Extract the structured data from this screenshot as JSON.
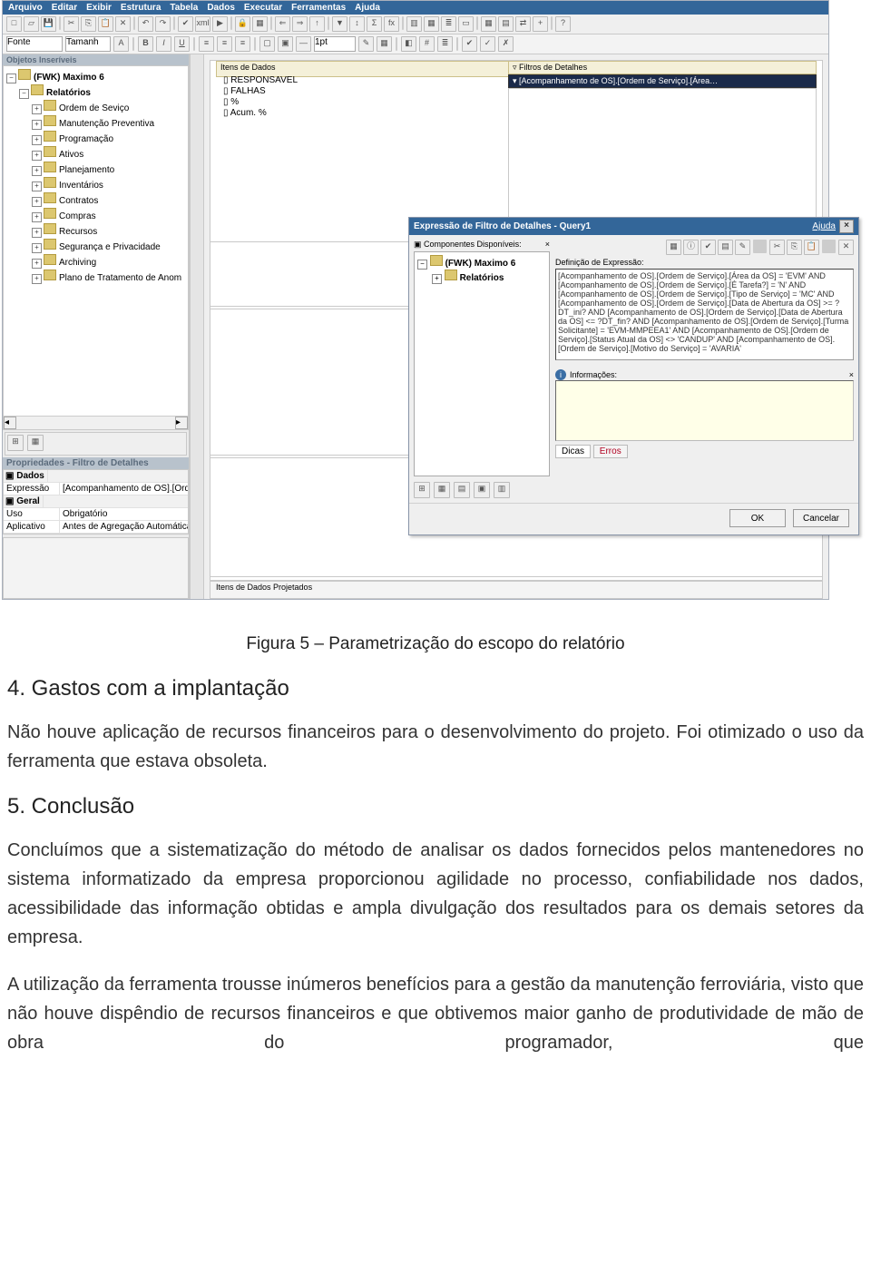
{
  "menu": {
    "items": [
      "Arquivo",
      "Editar",
      "Exibir",
      "Estrutura",
      "Tabela",
      "Dados",
      "Executar",
      "Ferramentas",
      "Ajuda"
    ]
  },
  "formatbar": {
    "font_label": "Fonte",
    "size_label": "Tamanh",
    "pt": "1pt"
  },
  "panels": {
    "objetos_title": "Objetos Inseríveis",
    "props_title": "Propriedades   -   Filtro de Detalhes"
  },
  "tree": {
    "root": "(FWK) Maximo 6",
    "relatorios": "Relatórios",
    "items": [
      "Ordem de Seviço",
      "Manutenção Preventiva",
      "Programação",
      "Ativos",
      "Planejamento",
      "Inventários",
      "Contratos",
      "Compras",
      "Recursos",
      "Segurança e Privacidade",
      "Archiving",
      "Plano de Tratamento de Anom"
    ]
  },
  "props": {
    "dados": "Dados",
    "expr_k": "Expressão",
    "expr_v": "[Acompanhamento de OS].[Orde…",
    "geral": "Geral",
    "uso_k": "Uso",
    "uso_v": "Obrigatório",
    "apl_k": "Aplicativo",
    "apl_v": "Antes de Agregação Automática"
  },
  "canvas": {
    "itens_header": "Itens de Dados",
    "itens": [
      "RESPONSAVEL",
      "FALHAS",
      "%",
      "Acum. %"
    ],
    "filtros_header": "Filtros de Detalhes",
    "filtros_row": "[Acompanhamento de OS].[Ordem de Serviço].[Área…",
    "status": "Itens de Dados Projetados"
  },
  "dialog": {
    "title": "Expressão de Filtro de Detalhes - Query1",
    "help": "Ajuda",
    "comp_label": "Componentes Disponíveis:",
    "tree_root": "(FWK) Maximo 6",
    "tree_child": "Relatórios",
    "def_label": "Definição de Expressão:",
    "expr": "[Acompanhamento de OS].[Ordem de Serviço].[Área da OS] = 'EVM' AND [Acompanhamento de OS].[Ordem de Serviço].[É Tarefa?] = 'N' AND [Acompanhamento de OS].[Ordem de Serviço].[Tipo de Serviço] = 'MC' AND [Acompanhamento de OS].[Ordem de Serviço].[Data de Abertura da OS] >= ?DT_ini? AND [Acompanhamento de OS].[Ordem de Serviço].[Data de Abertura da OS] <= ?DT_fin? AND [Acompanhamento de OS].[Ordem de Serviço].[Turma Solicitante] = 'EVM-MMPEEA1' AND [Acompanhamento de OS].[Ordem de Serviço].[Status Atual da OS] <> 'CANDUP' AND [Acompanhamento de OS].[Ordem de Serviço].[Motivo do Serviço]  =  'AVARIA'",
    "info_label": "Informações:",
    "tabs": [
      "Dicas",
      "Erros"
    ],
    "ok": "OK",
    "cancel": "Cancelar"
  },
  "doc": {
    "caption": "Figura 5 – Parametrização do escopo do relatório",
    "h4": "4. Gastos com a implantação",
    "p4": "Não houve aplicação de recursos financeiros para o desenvolvimento do projeto. Foi otimizado o uso da ferramenta que estava obsoleta.",
    "h5": "5. Conclusão",
    "p5a": "Concluímos que a sistematização do método de analisar os dados fornecidos pelos mantenedores no sistema informatizado da empresa proporcionou agilidade no processo, confiabilidade nos dados, acessibilidade das informação obtidas e ampla divulgação dos resultados para os demais setores da empresa.",
    "p5b": "A utilização da ferramenta trousse inúmeros benefícios para a gestão da manutenção ferroviária, visto que não houve dispêndio de recursos financeiros e que obtivemos maior ganho de produtividade de mão de obra do programador, que"
  }
}
